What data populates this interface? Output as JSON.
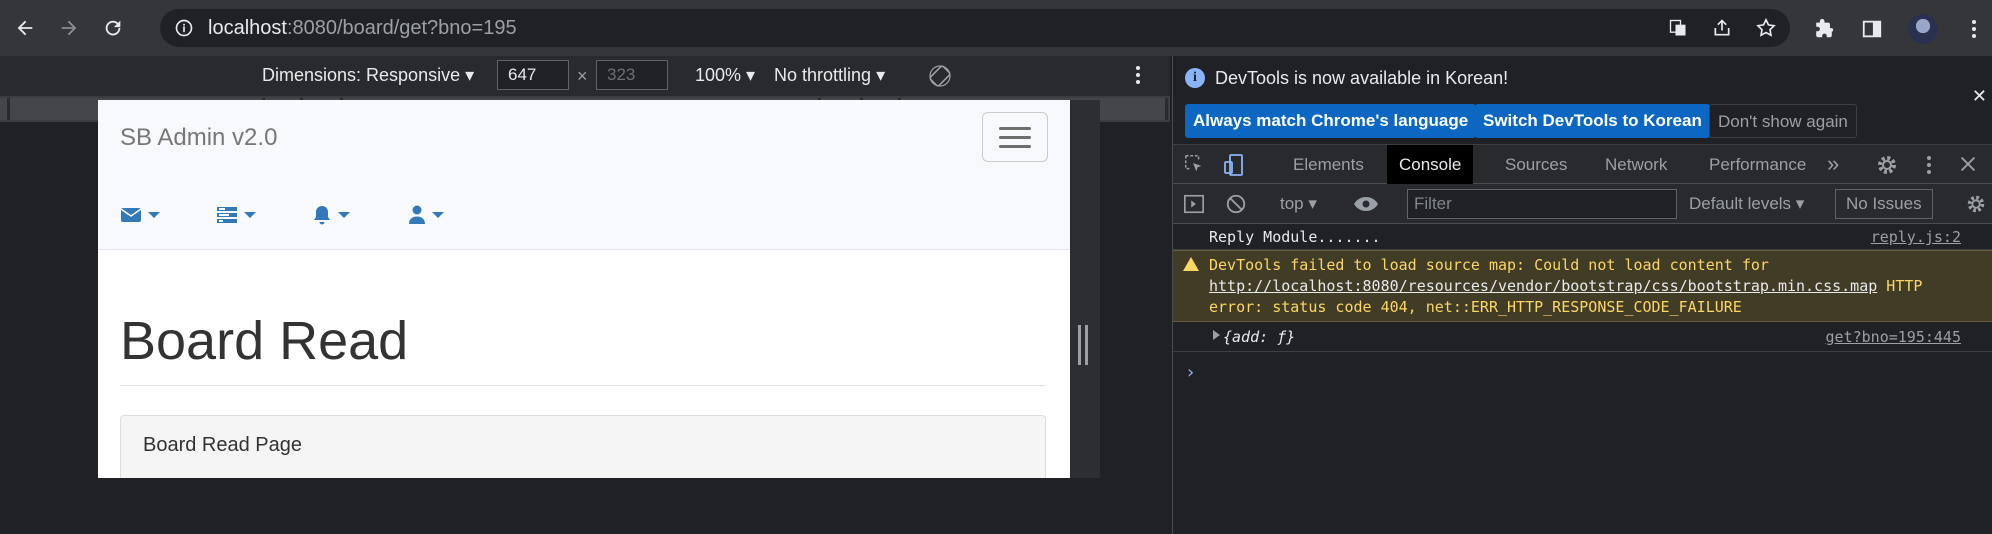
{
  "browser": {
    "url_host": "localhost",
    "url_rest": ":8080/board/get?bno=195"
  },
  "device_toolbar": {
    "dimensions_label": "Dimensions: Responsive",
    "width": "647",
    "height": "323",
    "times": "×",
    "zoom": "100%",
    "throttling": "No throttling"
  },
  "page": {
    "brand": "SB Admin v2.0",
    "title": "Board Read",
    "panel_heading": "Board Read Page"
  },
  "devtools": {
    "notice": "DevTools is now available in Korean!",
    "btn_match": "Always match Chrome's language",
    "btn_switch": "Switch DevTools to Korean",
    "btn_dismiss": "Don't show again",
    "tabs": [
      "Elements",
      "Console",
      "Sources",
      "Network",
      "Performance"
    ],
    "context": "top",
    "filter_placeholder": "Filter",
    "levels": "Default levels",
    "issues": "No Issues",
    "logs": [
      {
        "msg": "Reply Module.......",
        "src": "reply.js:2"
      },
      {
        "msg_pre": "DevTools failed to load source map: Could not load content for ",
        "link": "http://localhost:8080/resources/vendor/bootstrap/css/bootstrap.min.css.map",
        "msg_post": " HTTP error: status code 404, net::ERR_HTTP_RESPONSE_CODE_FAILURE"
      },
      {
        "msg": "{add: ƒ}",
        "src": "get?bno=195:445"
      }
    ],
    "prompt": "›"
  }
}
